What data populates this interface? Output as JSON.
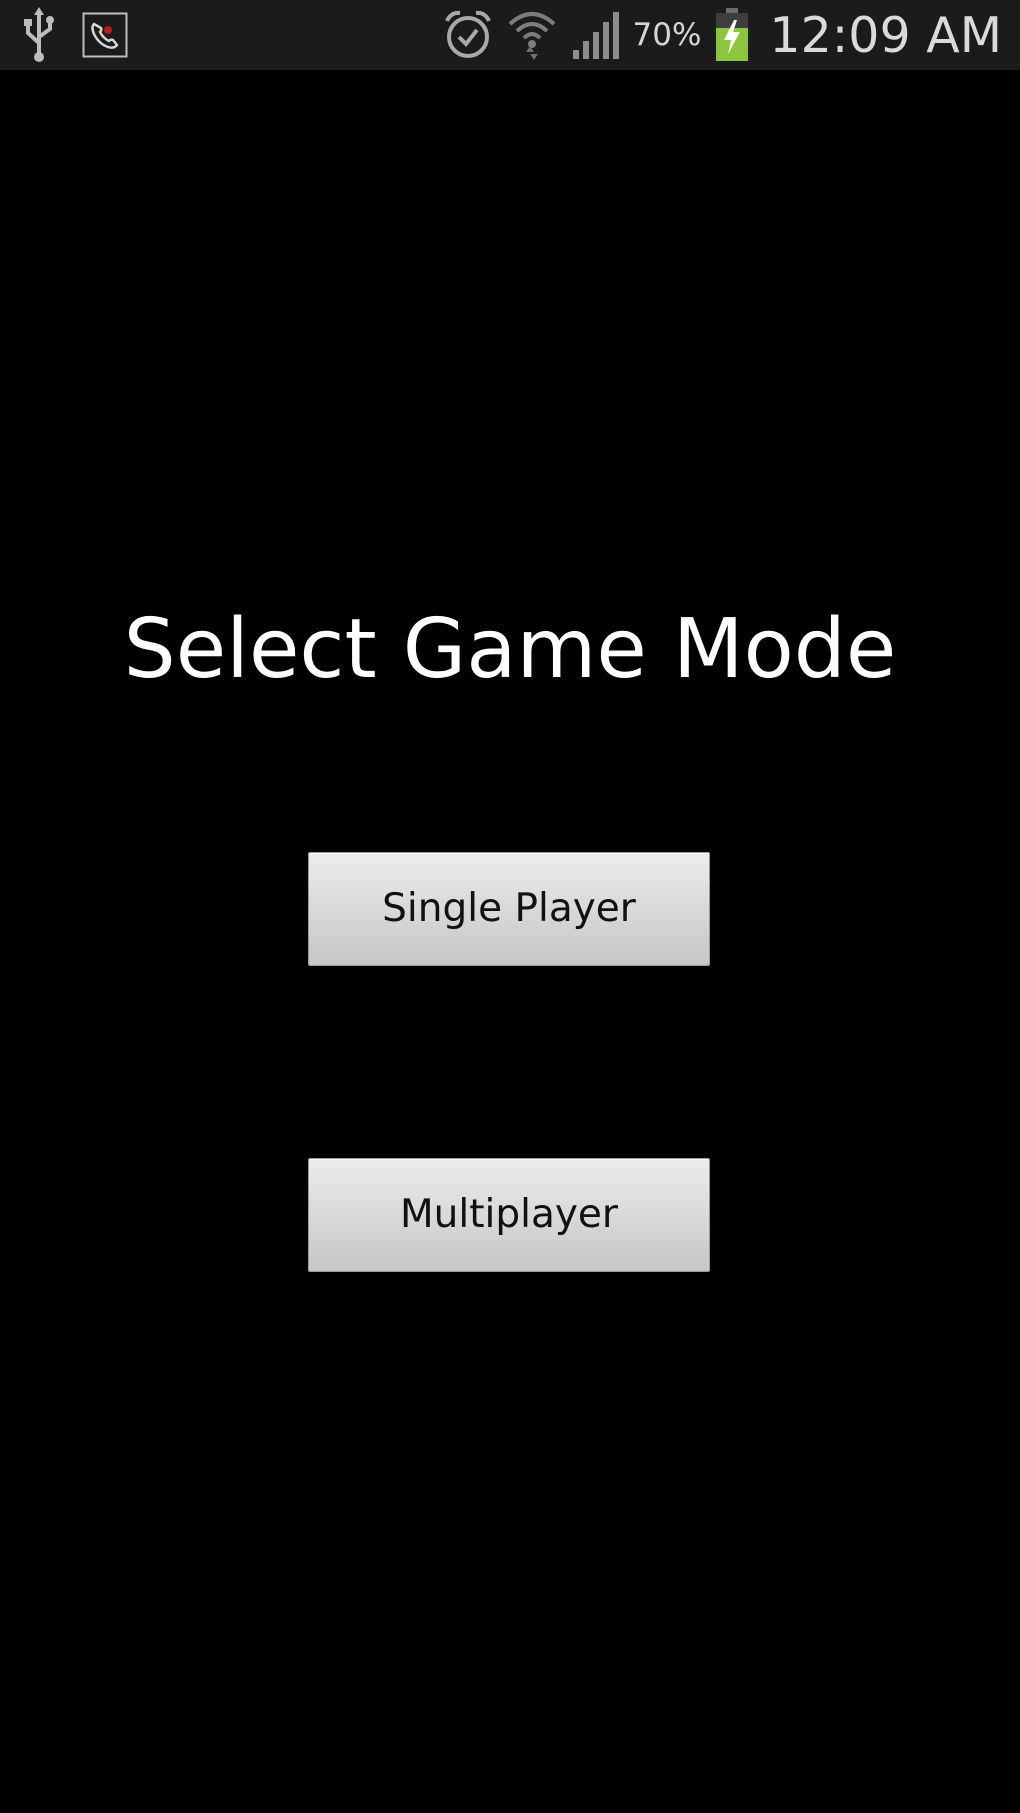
{
  "status_bar": {
    "battery_percent": "70%",
    "time": "12:09 AM",
    "icons": [
      "usb-icon",
      "voicemail-icon",
      "alarm-icon",
      "wifi-icon",
      "signal-icon",
      "battery-charging-icon"
    ],
    "battery_color": "#8cc63f"
  },
  "main": {
    "title": "Select Game Mode",
    "single_player_label": "Single Player",
    "multiplayer_label": "Multiplayer"
  }
}
